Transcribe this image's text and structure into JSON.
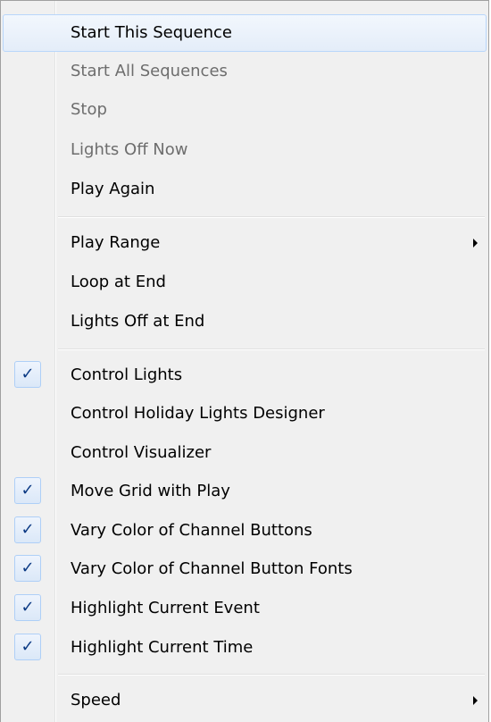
{
  "menu": {
    "items": [
      {
        "label": "Start This Sequence",
        "state": "hover"
      },
      {
        "label": "Start All Sequences",
        "state": "disabled"
      },
      {
        "label": "Stop",
        "state": "disabled"
      },
      {
        "label": "Lights Off Now",
        "state": "disabled"
      },
      {
        "label": "Play Again",
        "state": "enabled"
      },
      {
        "label": "Play Range",
        "state": "enabled",
        "submenu": true
      },
      {
        "label": "Loop at End",
        "state": "enabled"
      },
      {
        "label": "Lights Off at End",
        "state": "enabled"
      },
      {
        "label": "Control Lights",
        "state": "enabled",
        "checked": true
      },
      {
        "label": "Control Holiday Lights Designer",
        "state": "enabled"
      },
      {
        "label": "Control Visualizer",
        "state": "enabled"
      },
      {
        "label": "Move Grid with Play",
        "state": "enabled",
        "checked": true
      },
      {
        "label": "Vary Color of Channel Buttons",
        "state": "enabled",
        "checked": true
      },
      {
        "label": "Vary Color of Channel Button Fonts",
        "state": "enabled",
        "checked": true
      },
      {
        "label": "Highlight Current Event",
        "state": "enabled",
        "checked": true
      },
      {
        "label": "Highlight Current Time",
        "state": "enabled",
        "checked": true
      },
      {
        "label": "Speed",
        "state": "enabled",
        "submenu": true
      }
    ],
    "check_glyph": "✓",
    "colors": {
      "disabled_text": "#6d6d6d",
      "check": "#0c3a84",
      "hover_border": "#b8d6fb"
    }
  }
}
